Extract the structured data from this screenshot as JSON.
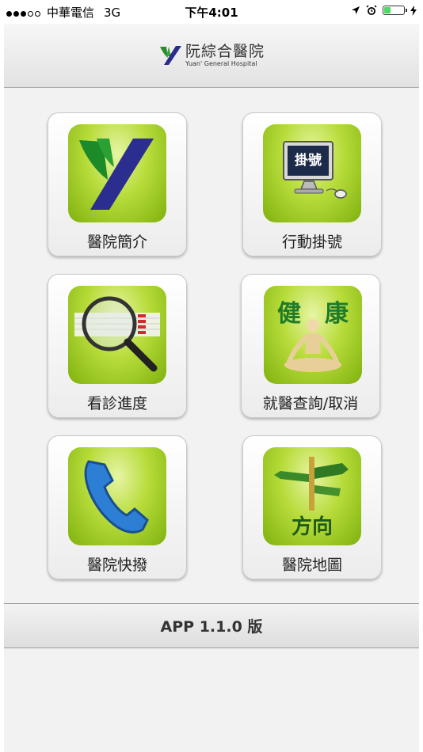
{
  "status_bar": {
    "carrier": "中華電信",
    "network": "3G",
    "time": "下午4:01",
    "signal_dots_filled": 3,
    "signal_dots_total": 5,
    "battery_level": 0.35,
    "battery_color": "#4cd964"
  },
  "header": {
    "logo_zh": "阮綜合醫院",
    "logo_en": "Yuan' General Hospital",
    "logo_icon": "yuan-logo-icon"
  },
  "menu": [
    {
      "label": "醫院簡介",
      "icon": "hospital-logo-icon",
      "icon_text": ""
    },
    {
      "label": "行動掛號",
      "icon": "computer-register-icon",
      "icon_text": "掛號"
    },
    {
      "label": "看診進度",
      "icon": "magnifier-progress-icon",
      "icon_text": ""
    },
    {
      "label": "就醫查詢/取消",
      "icon": "health-yoga-icon",
      "icon_text": "健　康"
    },
    {
      "label": "醫院快撥",
      "icon": "phone-icon",
      "icon_text": ""
    },
    {
      "label": "醫院地圖",
      "icon": "direction-signpost-icon",
      "icon_text": "方向"
    }
  ],
  "footer": {
    "version": "APP 1.1.0 版"
  },
  "colors": {
    "accent_green": "#8ec31a",
    "header_bg": "#ececec"
  }
}
